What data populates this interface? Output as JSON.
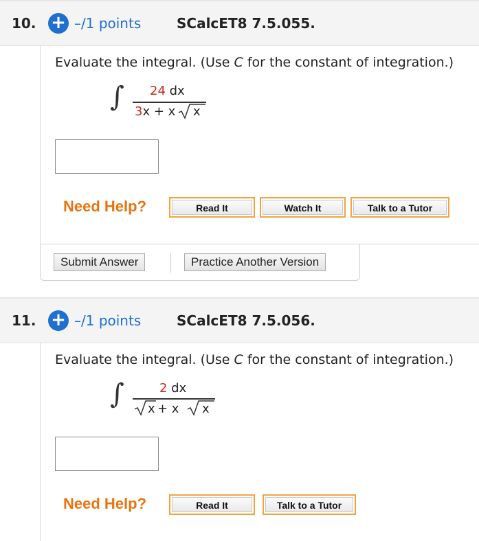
{
  "questions": [
    {
      "number": "10.",
      "points": "–/1 points",
      "code": "SCalcET8 7.5.055.",
      "prompt_before": "Evaluate the integral. (Use ",
      "prompt_var": "C",
      "prompt_after": " for the constant of integration.)",
      "numerator": {
        "coef": "24",
        "rest": " dx"
      },
      "denominator": {
        "coef": "3",
        "rest": "x + x"
      },
      "denominator_sqrt_arg": "x",
      "need_help": "Need Help?",
      "help_buttons": [
        "Read It",
        "Watch It",
        "Talk to a Tutor"
      ],
      "action_buttons": [
        "Submit Answer",
        "Practice Another Version"
      ]
    },
    {
      "number": "11.",
      "points": "–/1 points",
      "code": "SCalcET8 7.5.056.",
      "prompt_before": "Evaluate the integral. (Use ",
      "prompt_var": "C",
      "prompt_after": " for the constant of integration.)",
      "numerator": {
        "coef": "2",
        "rest": " dx"
      },
      "denominator_sqrt1_arg": "x",
      "denominator_mid": " + x",
      "denominator_sqrt2_arg": "x",
      "need_help": "Need Help?",
      "help_buttons": [
        "Read It",
        "Talk to a Tutor"
      ]
    }
  ],
  "colors": {
    "accent_blue": "#1e6fd0",
    "coef_red": "#c62b1c",
    "help_orange": "#e8740f"
  },
  "icons": {
    "plus": "plus-circle-icon",
    "integral": "integral-sign"
  }
}
